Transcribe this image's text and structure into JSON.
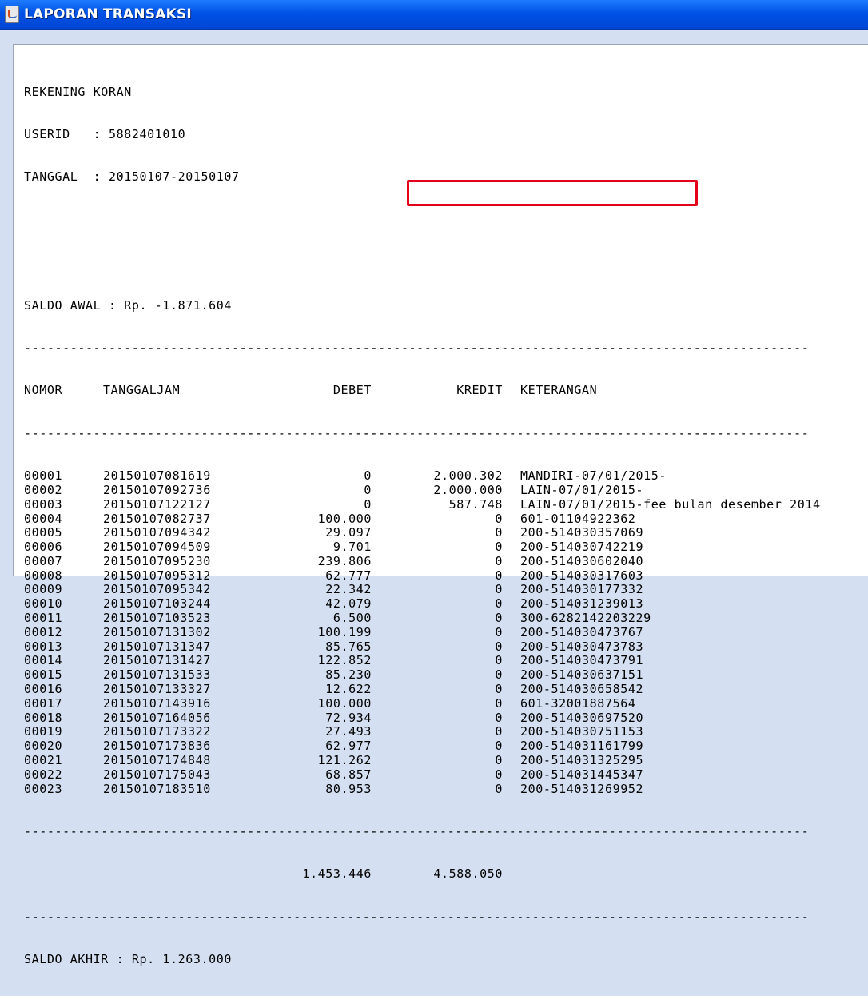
{
  "window": {
    "title": "LAPORAN TRANSAKSI"
  },
  "report": {
    "heading": "REKENING KORAN",
    "userid_label": "USERID   :",
    "userid": "5882401010",
    "tanggal_label": "TANGGAL  :",
    "tanggal": "20150107-20150107",
    "saldo_awal_label": "SALDO AWAL : Rp.",
    "saldo_awal": "-1.871.604",
    "divider": "------------------------------------------------------------------------------------------------------",
    "columns": {
      "nomor": "NOMOR",
      "tanggaljam": "TANGGALJAM",
      "debet": "DEBET",
      "kredit": "KREDIT",
      "keterangan": "KETERANGAN"
    },
    "rows": [
      {
        "nomor": "00001",
        "tanggaljam": "20150107081619",
        "debet": "0",
        "kredit": "2.000.302",
        "keterangan": "MANDIRI-07/01/2015-"
      },
      {
        "nomor": "00002",
        "tanggaljam": "20150107092736",
        "debet": "0",
        "kredit": "2.000.000",
        "keterangan": "LAIN-07/01/2015-"
      },
      {
        "nomor": "00003",
        "tanggaljam": "20150107122127",
        "debet": "0",
        "kredit": "587.748",
        "keterangan": "LAIN-07/01/2015-fee bulan desember 2014"
      },
      {
        "nomor": "00004",
        "tanggaljam": "20150107082737",
        "debet": "100.000",
        "kredit": "0",
        "keterangan": "601-01104922362"
      },
      {
        "nomor": "00005",
        "tanggaljam": "20150107094342",
        "debet": "29.097",
        "kredit": "0",
        "keterangan": "200-514030357069"
      },
      {
        "nomor": "00006",
        "tanggaljam": "20150107094509",
        "debet": "9.701",
        "kredit": "0",
        "keterangan": "200-514030742219"
      },
      {
        "nomor": "00007",
        "tanggaljam": "20150107095230",
        "debet": "239.806",
        "kredit": "0",
        "keterangan": "200-514030602040"
      },
      {
        "nomor": "00008",
        "tanggaljam": "20150107095312",
        "debet": "62.777",
        "kredit": "0",
        "keterangan": "200-514030317603"
      },
      {
        "nomor": "00009",
        "tanggaljam": "20150107095342",
        "debet": "22.342",
        "kredit": "0",
        "keterangan": "200-514030177332"
      },
      {
        "nomor": "00010",
        "tanggaljam": "20150107103244",
        "debet": "42.079",
        "kredit": "0",
        "keterangan": "200-514031239013"
      },
      {
        "nomor": "00011",
        "tanggaljam": "20150107103523",
        "debet": "6.500",
        "kredit": "0",
        "keterangan": "300-6282142203229"
      },
      {
        "nomor": "00012",
        "tanggaljam": "20150107131302",
        "debet": "100.199",
        "kredit": "0",
        "keterangan": "200-514030473767"
      },
      {
        "nomor": "00013",
        "tanggaljam": "20150107131347",
        "debet": "85.765",
        "kredit": "0",
        "keterangan": "200-514030473783"
      },
      {
        "nomor": "00014",
        "tanggaljam": "20150107131427",
        "debet": "122.852",
        "kredit": "0",
        "keterangan": "200-514030473791"
      },
      {
        "nomor": "00015",
        "tanggaljam": "20150107131533",
        "debet": "85.230",
        "kredit": "0",
        "keterangan": "200-514030637151"
      },
      {
        "nomor": "00016",
        "tanggaljam": "20150107133327",
        "debet": "12.622",
        "kredit": "0",
        "keterangan": "200-514030658542"
      },
      {
        "nomor": "00017",
        "tanggaljam": "20150107143916",
        "debet": "100.000",
        "kredit": "0",
        "keterangan": "601-32001887564"
      },
      {
        "nomor": "00018",
        "tanggaljam": "20150107164056",
        "debet": "72.934",
        "kredit": "0",
        "keterangan": "200-514030697520"
      },
      {
        "nomor": "00019",
        "tanggaljam": "20150107173322",
        "debet": "27.493",
        "kredit": "0",
        "keterangan": "200-514030751153"
      },
      {
        "nomor": "00020",
        "tanggaljam": "20150107173836",
        "debet": "62.977",
        "kredit": "0",
        "keterangan": "200-514031161799"
      },
      {
        "nomor": "00021",
        "tanggaljam": "20150107174848",
        "debet": "121.262",
        "kredit": "0",
        "keterangan": "200-514031325295"
      },
      {
        "nomor": "00022",
        "tanggaljam": "20150107175043",
        "debet": "68.857",
        "kredit": "0",
        "keterangan": "200-514031445347"
      },
      {
        "nomor": "00023",
        "tanggaljam": "20150107183510",
        "debet": "80.953",
        "kredit": "0",
        "keterangan": "200-514031269952"
      }
    ],
    "total_debet": "1.453.446",
    "total_kredit": "4.588.050",
    "saldo_akhir_label": "SALDO AKHIR : Rp.",
    "saldo_akhir": "1.263.000"
  },
  "colors": {
    "titlebar": "#0052e6",
    "highlight_box": "#e5001b"
  }
}
